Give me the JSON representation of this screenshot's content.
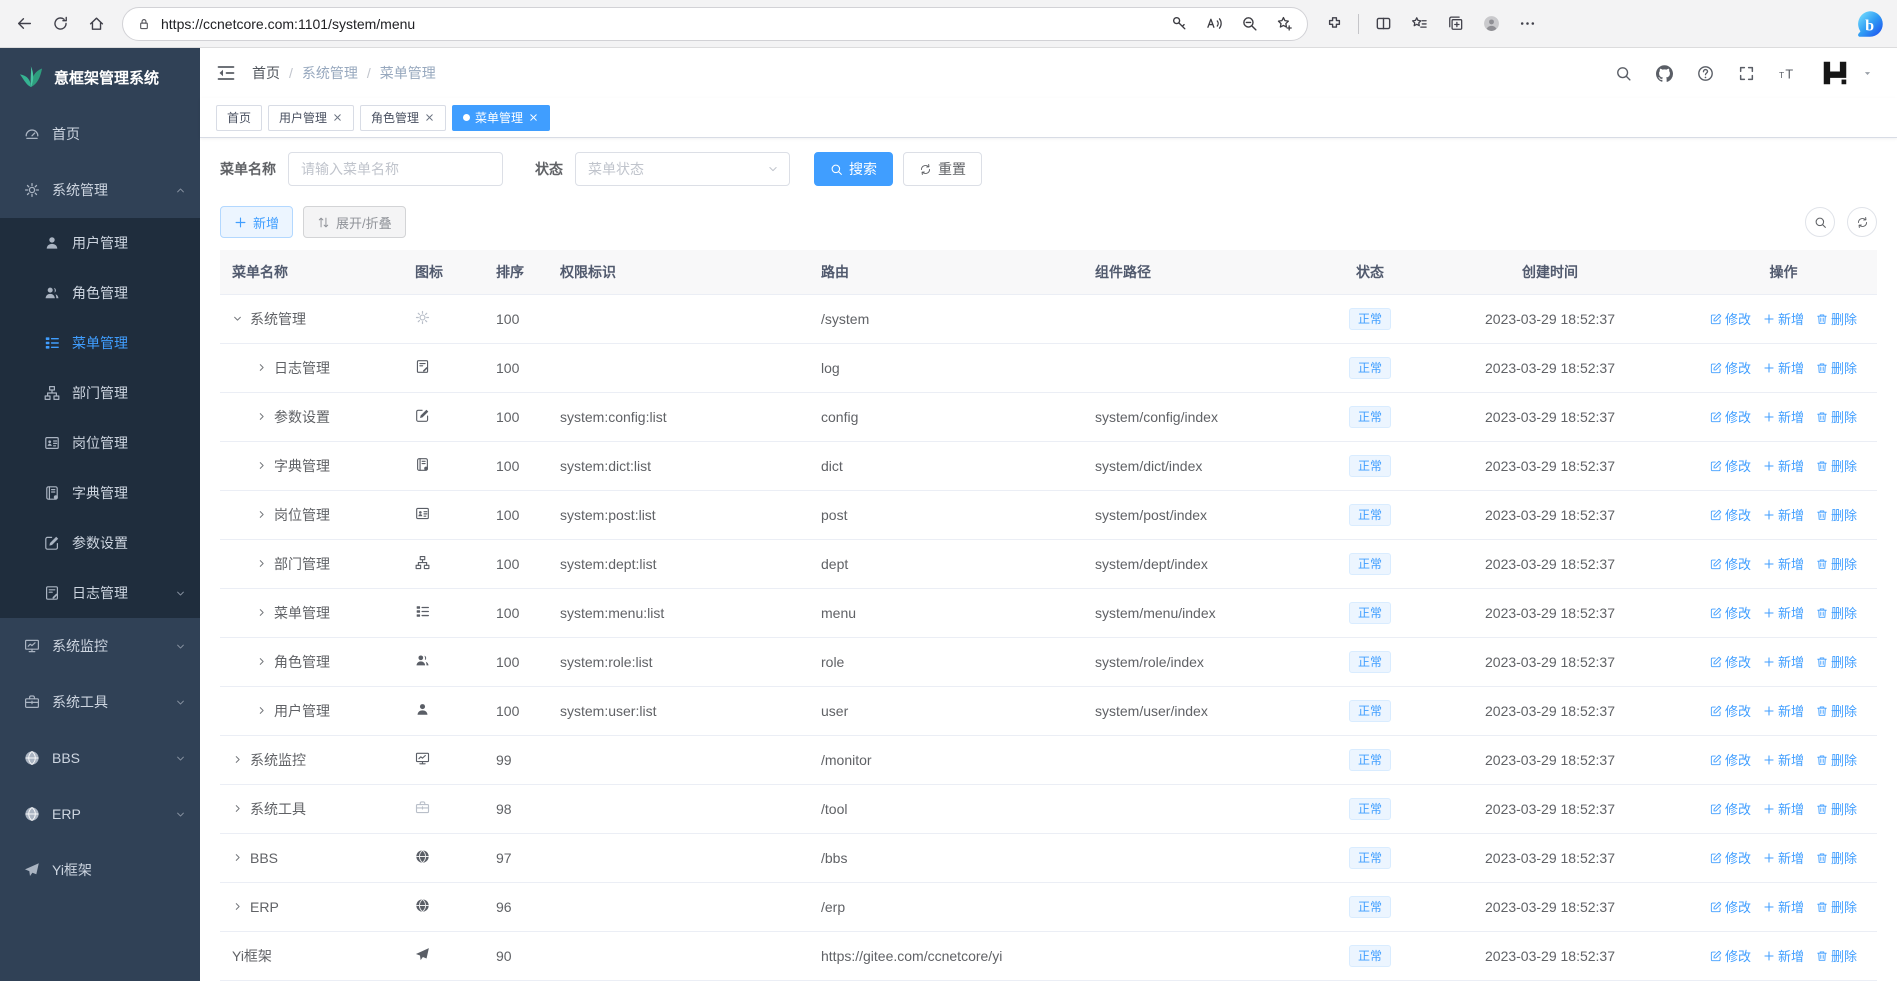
{
  "browser": {
    "url": "https://ccnetcore.com:1101/system/menu"
  },
  "app": {
    "logo": {
      "title": "意框架管理系统"
    },
    "sidebar": [
      {
        "key": "home",
        "label": "首页",
        "icon": "dashboard-icon"
      },
      {
        "key": "system-admin",
        "label": "系统管理",
        "icon": "gear-icon",
        "expanded": true,
        "children": [
          {
            "key": "user-admin",
            "label": "用户管理",
            "icon": "user-icon"
          },
          {
            "key": "role-admin",
            "label": "角色管理",
            "icon": "users-icon"
          },
          {
            "key": "menu-admin",
            "label": "菜单管理",
            "icon": "menu-list-icon",
            "active": true
          },
          {
            "key": "dept-admin",
            "label": "部门管理",
            "icon": "org-tree-icon"
          },
          {
            "key": "post-admin",
            "label": "岗位管理",
            "icon": "badge-icon"
          },
          {
            "key": "dict-admin",
            "label": "字典管理",
            "icon": "dict-book-icon"
          },
          {
            "key": "config-admin",
            "label": "参数设置",
            "icon": "edit-square-icon"
          },
          {
            "key": "log-admin",
            "label": "日志管理",
            "icon": "log-icon",
            "collapsible": true
          }
        ]
      },
      {
        "key": "monitor",
        "label": "系统监控",
        "icon": "monitor-icon",
        "collapsible": true
      },
      {
        "key": "tools",
        "label": "系统工具",
        "icon": "toolbox-icon",
        "collapsible": true
      },
      {
        "key": "bbs",
        "label": "BBS",
        "icon": "globe-icon",
        "collapsible": true
      },
      {
        "key": "erp",
        "label": "ERP",
        "icon": "globe-icon",
        "collapsible": true
      },
      {
        "key": "yi-framework",
        "label": "Yi框架",
        "icon": "paper-plane-icon"
      }
    ],
    "breadcrumb": [
      "首页",
      "系统管理",
      "菜单管理"
    ],
    "tabs": [
      {
        "key": "home",
        "label": "首页",
        "closable": false,
        "active": false
      },
      {
        "key": "user-admin",
        "label": "用户管理",
        "closable": true,
        "active": false
      },
      {
        "key": "role-admin",
        "label": "角色管理",
        "closable": true,
        "active": false
      },
      {
        "key": "menu-admin",
        "label": "菜单管理",
        "closable": true,
        "active": true
      }
    ],
    "filters": {
      "name_label": "菜单名称",
      "name_placeholder": "请输入菜单名称",
      "status_label": "状态",
      "status_placeholder": "菜单状态",
      "search_label": "搜索",
      "reset_label": "重置"
    },
    "toolbar": {
      "add_label": "新增",
      "toggle_label": "展开/折叠"
    },
    "table": {
      "columns": [
        "菜单名称",
        "图标",
        "排序",
        "权限标识",
        "路由",
        "组件路径",
        "状态",
        "创建时间",
        "操作"
      ],
      "actions": {
        "edit": "修改",
        "add": "新增",
        "delete": "删除"
      },
      "rows": [
        {
          "key": "system",
          "name": "系统管理",
          "level": 1,
          "expand": "down",
          "icon": "gear-icon",
          "muted": true,
          "order": "100",
          "perm": "",
          "route": "/system",
          "component": "",
          "status": "正常",
          "created": "2023-03-29 18:52:37"
        },
        {
          "key": "log",
          "name": "日志管理",
          "level": 2,
          "expand": "right",
          "icon": "log-icon",
          "muted": false,
          "order": "100",
          "perm": "",
          "route": "log",
          "component": "",
          "status": "正常",
          "created": "2023-03-29 18:52:37"
        },
        {
          "key": "config",
          "name": "参数设置",
          "level": 2,
          "expand": "right",
          "icon": "edit-square-icon",
          "muted": false,
          "order": "100",
          "perm": "system:config:list",
          "route": "config",
          "component": "system/config/index",
          "status": "正常",
          "created": "2023-03-29 18:52:37"
        },
        {
          "key": "dict",
          "name": "字典管理",
          "level": 2,
          "expand": "right",
          "icon": "dict-book-icon",
          "muted": false,
          "order": "100",
          "perm": "system:dict:list",
          "route": "dict",
          "component": "system/dict/index",
          "status": "正常",
          "created": "2023-03-29 18:52:37"
        },
        {
          "key": "post",
          "name": "岗位管理",
          "level": 2,
          "expand": "right",
          "icon": "badge-icon",
          "muted": false,
          "order": "100",
          "perm": "system:post:list",
          "route": "post",
          "component": "system/post/index",
          "status": "正常",
          "created": "2023-03-29 18:52:37"
        },
        {
          "key": "dept",
          "name": "部门管理",
          "level": 2,
          "expand": "right",
          "icon": "org-tree-icon",
          "muted": false,
          "order": "100",
          "perm": "system:dept:list",
          "route": "dept",
          "component": "system/dept/index",
          "status": "正常",
          "created": "2023-03-29 18:52:37"
        },
        {
          "key": "menu",
          "name": "菜单管理",
          "level": 2,
          "expand": "right",
          "icon": "menu-list-icon",
          "muted": false,
          "order": "100",
          "perm": "system:menu:list",
          "route": "menu",
          "component": "system/menu/index",
          "status": "正常",
          "created": "2023-03-29 18:52:37"
        },
        {
          "key": "role",
          "name": "角色管理",
          "level": 2,
          "expand": "right",
          "icon": "users-icon",
          "muted": false,
          "order": "100",
          "perm": "system:role:list",
          "route": "role",
          "component": "system/role/index",
          "status": "正常",
          "created": "2023-03-29 18:52:37"
        },
        {
          "key": "user",
          "name": "用户管理",
          "level": 2,
          "expand": "right",
          "icon": "user-icon",
          "muted": false,
          "order": "100",
          "perm": "system:user:list",
          "route": "user",
          "component": "system/user/index",
          "status": "正常",
          "created": "2023-03-29 18:52:37"
        },
        {
          "key": "monitor",
          "name": "系统监控",
          "level": 1,
          "expand": "right",
          "icon": "monitor-icon",
          "muted": false,
          "order": "99",
          "perm": "",
          "route": "/monitor",
          "component": "",
          "status": "正常",
          "created": "2023-03-29 18:52:37"
        },
        {
          "key": "tool",
          "name": "系统工具",
          "level": 1,
          "expand": "right",
          "icon": "toolbox-icon",
          "muted": true,
          "order": "98",
          "perm": "",
          "route": "/tool",
          "component": "",
          "status": "正常",
          "created": "2023-03-29 18:52:37"
        },
        {
          "key": "bbs",
          "name": "BBS",
          "level": 1,
          "expand": "right",
          "icon": "globe-icon",
          "muted": false,
          "order": "97",
          "perm": "",
          "route": "/bbs",
          "component": "",
          "status": "正常",
          "created": "2023-03-29 18:52:37"
        },
        {
          "key": "erp",
          "name": "ERP",
          "level": 1,
          "expand": "right",
          "icon": "globe-icon",
          "muted": false,
          "order": "96",
          "perm": "",
          "route": "/erp",
          "component": "",
          "status": "正常",
          "created": "2023-03-29 18:52:37"
        },
        {
          "key": "yi",
          "name": "Yi框架",
          "level": 1,
          "expand": "none",
          "icon": "paper-plane-icon",
          "muted": false,
          "order": "90",
          "perm": "",
          "route": "https://gitee.com/ccnetcore/yi",
          "component": "",
          "status": "正常",
          "created": "2023-03-29 18:52:37"
        }
      ]
    },
    "colors": {
      "primary": "#409eff",
      "sidebar_bg": "#304156",
      "submenu_bg": "#1f2d3d",
      "status_bg": "#ecf5ff",
      "status_border": "#d9ecff"
    }
  }
}
